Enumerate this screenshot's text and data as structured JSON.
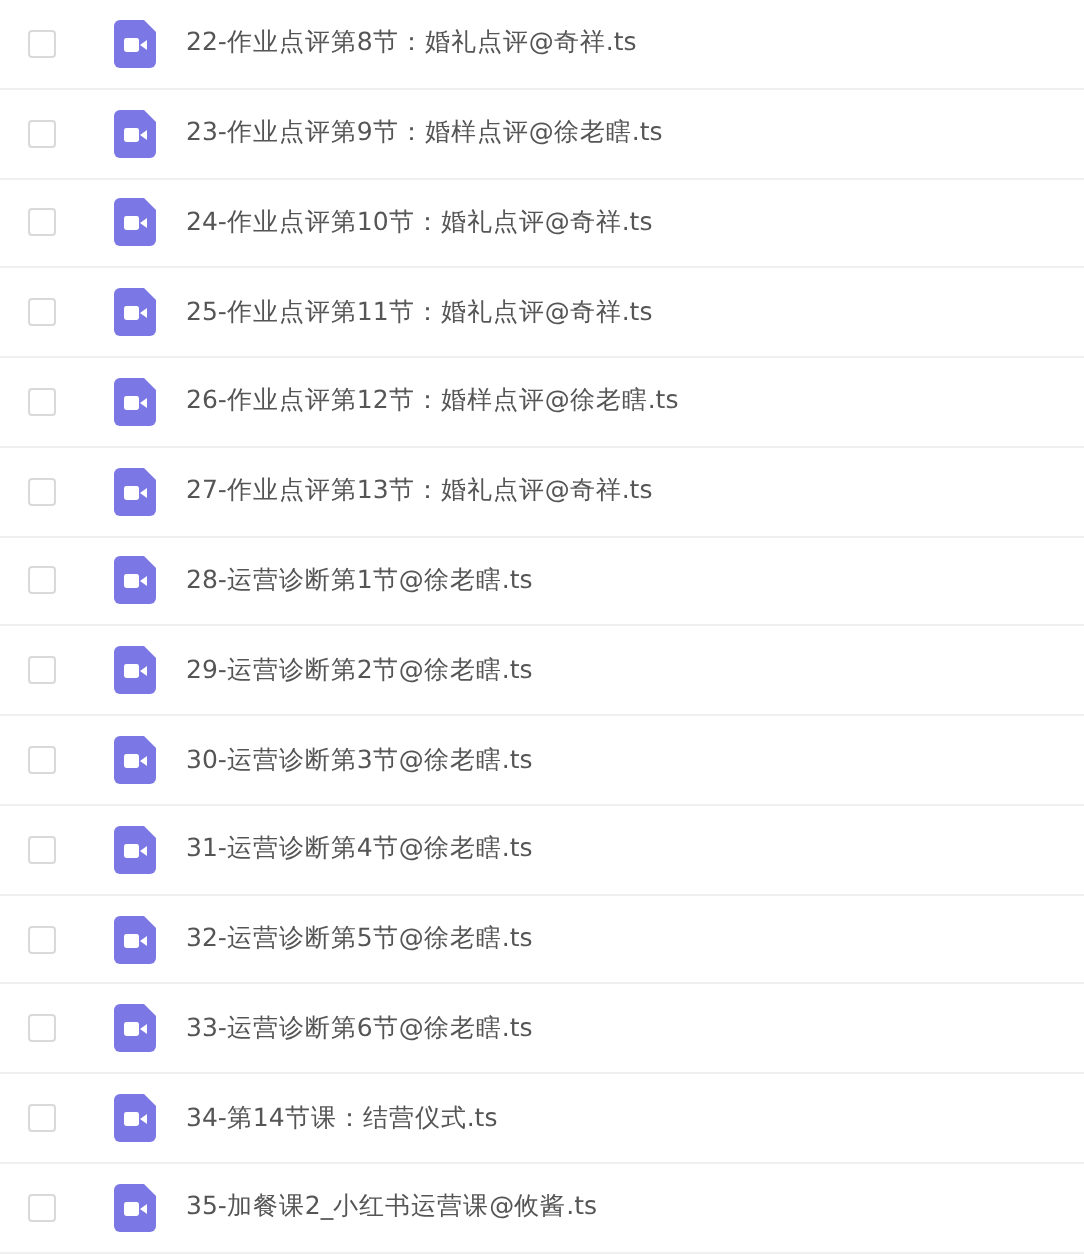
{
  "files": [
    {
      "name": "22-作业点评第8节：婚礼点评@奇祥.ts",
      "checked": false
    },
    {
      "name": "23-作业点评第9节：婚样点评@徐老瞎.ts",
      "checked": false
    },
    {
      "name": "24-作业点评第10节：婚礼点评@奇祥.ts",
      "checked": false
    },
    {
      "name": "25-作业点评第11节：婚礼点评@奇祥.ts",
      "checked": false
    },
    {
      "name": "26-作业点评第12节：婚样点评@徐老瞎.ts",
      "checked": false
    },
    {
      "name": "27-作业点评第13节：婚礼点评@奇祥.ts",
      "checked": false
    },
    {
      "name": "28-运营诊断第1节@徐老瞎.ts",
      "checked": false
    },
    {
      "name": "29-运营诊断第2节@徐老瞎.ts",
      "checked": false
    },
    {
      "name": "30-运营诊断第3节@徐老瞎.ts",
      "checked": false
    },
    {
      "name": "31-运营诊断第4节@徐老瞎.ts",
      "checked": false
    },
    {
      "name": "32-运营诊断第5节@徐老瞎.ts",
      "checked": false
    },
    {
      "name": "33-运营诊断第6节@徐老瞎.ts",
      "checked": false
    },
    {
      "name": "34-第14节课：结营仪式.ts",
      "checked": false
    },
    {
      "name": "35-加餐课2_小红书运营课@攸酱.ts",
      "checked": false
    }
  ]
}
